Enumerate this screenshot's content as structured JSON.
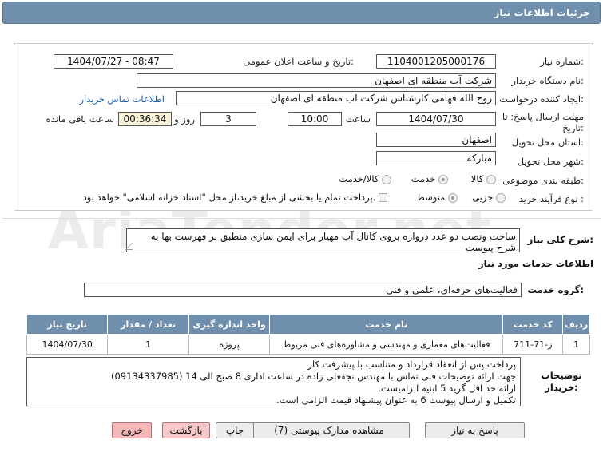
{
  "header": {
    "title": "جزئیات اطلاعات نیاز"
  },
  "form": {
    "need_number_label": "شماره نیاز:",
    "need_number": "1104001205000176",
    "announce_label": "تاریخ و ساعت اعلان عمومی:",
    "announce_value": "1404/07/27 - 08:47",
    "buyer_org_label": "نام دستگاه خریدار:",
    "buyer_org": "شرکت آب منطقه ای اصفهان",
    "creator_label": "ایجاد کننده درخواست:",
    "creator": "روح الله فهامی کارشناس شرکت آب منطقه ای اصفهان",
    "contact_link": "اطلاعات تماس خریدار",
    "deadline_label": "مهلت ارسال پاسخ: تا تاریخ:",
    "deadline_date": "1404/07/30",
    "time_label": "ساعت",
    "deadline_time": "10:00",
    "days_value": "3",
    "days_label": "روز و",
    "remaining_time": "00:36:34",
    "remaining_label": "ساعت باقی مانده",
    "province_label": "استان محل تحویل:",
    "province": "اصفهان",
    "city_label": "شهر محل تحویل:",
    "city": "مبارکه",
    "category_label": "طبقه بندی موضوعی:",
    "category_options": [
      "کالا",
      "خدمت",
      "کالا/خدمت"
    ],
    "process_label": "نوع فرآیند خرید :",
    "process_options": [
      "جزیی",
      "متوسط"
    ],
    "payment_note": "پرداخت تمام یا بخشی از مبلغ خرید،از محل \"اسناد خزانه اسلامی\" خواهد بود."
  },
  "general": {
    "label": "شرح کلی نیاز:",
    "text": "ساخت ونصب دو عدد دروازه بروی کانال آب  مهیار برای ایمن سازی منطبق بر فهرست بها به شرح پیوست"
  },
  "services": {
    "section_title": "اطلاعات خدمات مورد نیاز",
    "group_label": "گروه خدمت:",
    "group_value": "فعالیت‌های حرفه‌ای، علمی و فنی",
    "columns": [
      "ردیف",
      "کد خدمت",
      "نام خدمت",
      "واحد اندازه گیری",
      "تعداد / مقدار",
      "تاریخ نیاز"
    ],
    "rows": [
      [
        "1",
        "ز-71-711",
        "فعالیت‌های معماری و مهندسی و مشاوره‌های فنی مربوط",
        "پروژه",
        "1",
        "1404/07/30"
      ]
    ]
  },
  "buyer_desc": {
    "label": "توضیحات خریدار:",
    "lines": [
      "پرداخت پس از انعقاد قرارداد و متناسب با پیشرفت کار",
      "جهت ارائه توضیحات فنی تماس با مهندس نجفعلی زاده در ساعت اداری 8 صبح الی 14 (09134337985)",
      "ارائه حد اقل گرید 5 ابنیه الزامیست.",
      "تکمیل و ارسال پیوست 6 به عنوان پیشنهاد قیمت الزامی است."
    ]
  },
  "buttons": {
    "reply": "پاسخ به نیاز",
    "view_docs": "مشاهده مدارک پیوستی (7)",
    "print": "چاپ",
    "back": "بازگشت",
    "exit": "خروج"
  },
  "watermark": "AriaTender.net"
}
